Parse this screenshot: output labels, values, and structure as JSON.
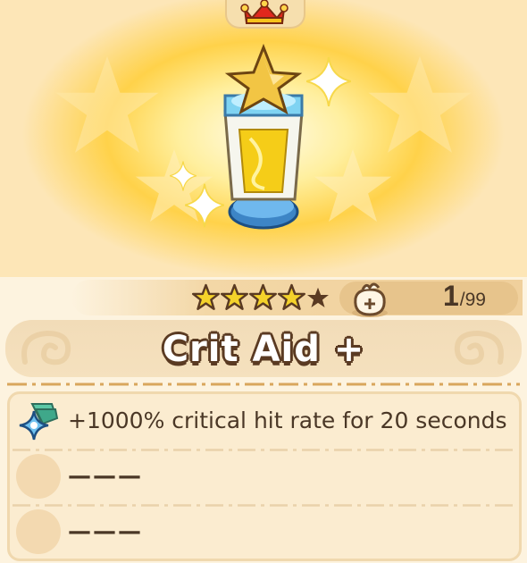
{
  "item": {
    "name": "Crit Aid +",
    "stars_filled": 4,
    "stars_total": 5,
    "owned": "1",
    "max": "/99"
  },
  "effects": [
    {
      "icon": "crit-sparkle-icon",
      "text": "+1000% critical hit rate for 20 seconds"
    },
    {
      "icon": "empty-slot-icon",
      "text": "———"
    },
    {
      "icon": "empty-slot-icon",
      "text": "———"
    }
  ],
  "icons": {
    "header": "crown-icon",
    "item": "potion-bottle-icon",
    "bag": "bag-icon"
  },
  "colors": {
    "background": "#fdf3df",
    "glow": "#ffd24a",
    "text": "#4a3726",
    "star_filled": "#f4d22a",
    "star_empty": "#5a3a22"
  }
}
